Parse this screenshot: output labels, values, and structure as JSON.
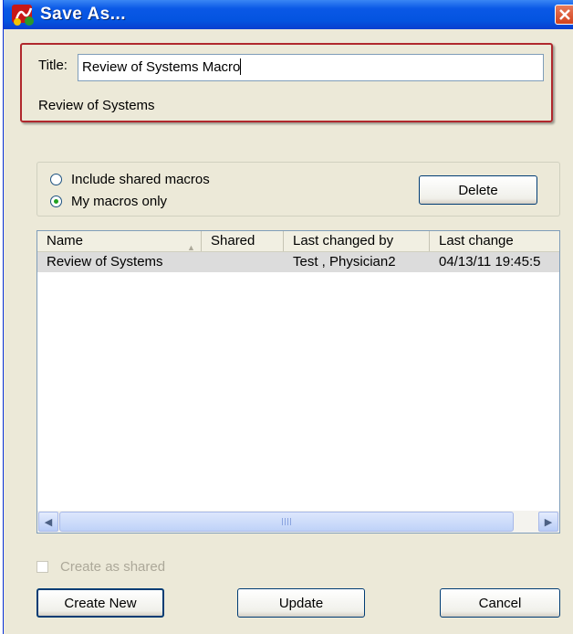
{
  "window": {
    "title": "Save As..."
  },
  "form": {
    "title_label": "Title:",
    "title_value": "Review of Systems Macro",
    "subtitle": "Review of Systems"
  },
  "options": {
    "include_shared_label": "Include shared macros",
    "my_macros_label": "My macros only",
    "selected": "My macros only",
    "delete_label": "Delete"
  },
  "table": {
    "columns": [
      "Name",
      "Shared",
      "Last changed by",
      "Last change"
    ],
    "rows": [
      {
        "name": "Review of Systems",
        "shared": "",
        "last_changed_by": "Test , Physician2",
        "last_change": "04/13/11 19:45:5"
      }
    ]
  },
  "footer": {
    "create_shared_label": "Create as shared",
    "create_new_label": "Create New",
    "update_label": "Update",
    "cancel_label": "Cancel"
  },
  "colors": {
    "titlebar": "#0454e0",
    "window_bg": "#ece9d8",
    "highlight_frame": "#b0282d",
    "selected_row": "#dcdcdc"
  }
}
